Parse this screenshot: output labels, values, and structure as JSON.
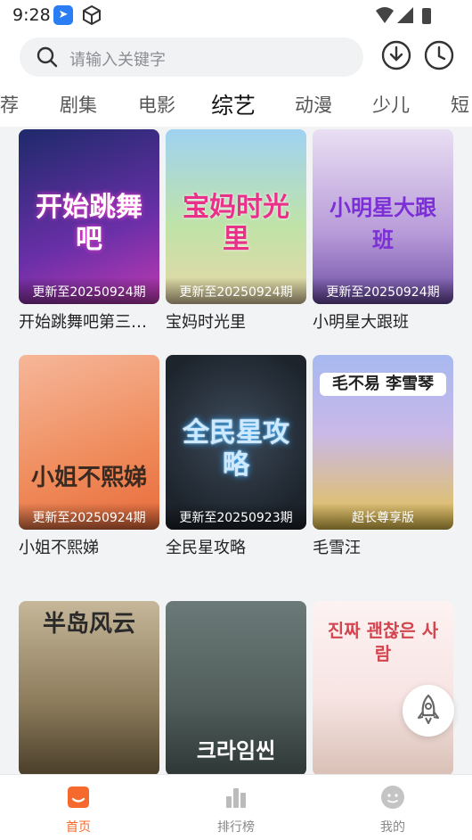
{
  "status_bar": {
    "time": "9:28"
  },
  "search": {
    "placeholder": "请输入关键字"
  },
  "tabs": [
    {
      "label": "荐"
    },
    {
      "label": "剧集"
    },
    {
      "label": "电影"
    },
    {
      "label": "综艺"
    },
    {
      "label": "动漫"
    },
    {
      "label": "少儿"
    },
    {
      "label": "短"
    }
  ],
  "active_tab": "综艺",
  "items": [
    {
      "name": "开始跳舞吧第三…",
      "badge": "更新至20250924期",
      "poster_text": "开始跳舞吧"
    },
    {
      "name": "宝妈时光里",
      "badge": "更新至20250924期",
      "poster_text": "宝妈时光里"
    },
    {
      "name": "小明星大跟班",
      "badge": "更新至20250924期",
      "poster_text": "小明星大跟班"
    },
    {
      "name": "小姐不熙娣",
      "badge": "更新至20250924期",
      "poster_text": "小姐不熙娣"
    },
    {
      "name": "全民星攻略",
      "badge": "更新至20250923期",
      "poster_text": "全民星攻略"
    },
    {
      "name": "毛雪汪",
      "badge": "超长尊享版",
      "poster_text": "毛不易 李雪琴"
    },
    {
      "name": "",
      "badge": "",
      "poster_text": "半岛风云"
    },
    {
      "name": "",
      "badge": "",
      "poster_text": "크라임씬"
    },
    {
      "name": "",
      "badge": "",
      "poster_text": "진짜 괜찮은 사람"
    }
  ],
  "bottom_nav": [
    {
      "label": "首页",
      "icon": "home-icon"
    },
    {
      "label": "排行榜",
      "icon": "ranking-icon"
    },
    {
      "label": "我的",
      "icon": "profile-icon"
    }
  ],
  "colors": {
    "accent": "#f56a2c",
    "app_badge": "#2b7df4"
  }
}
